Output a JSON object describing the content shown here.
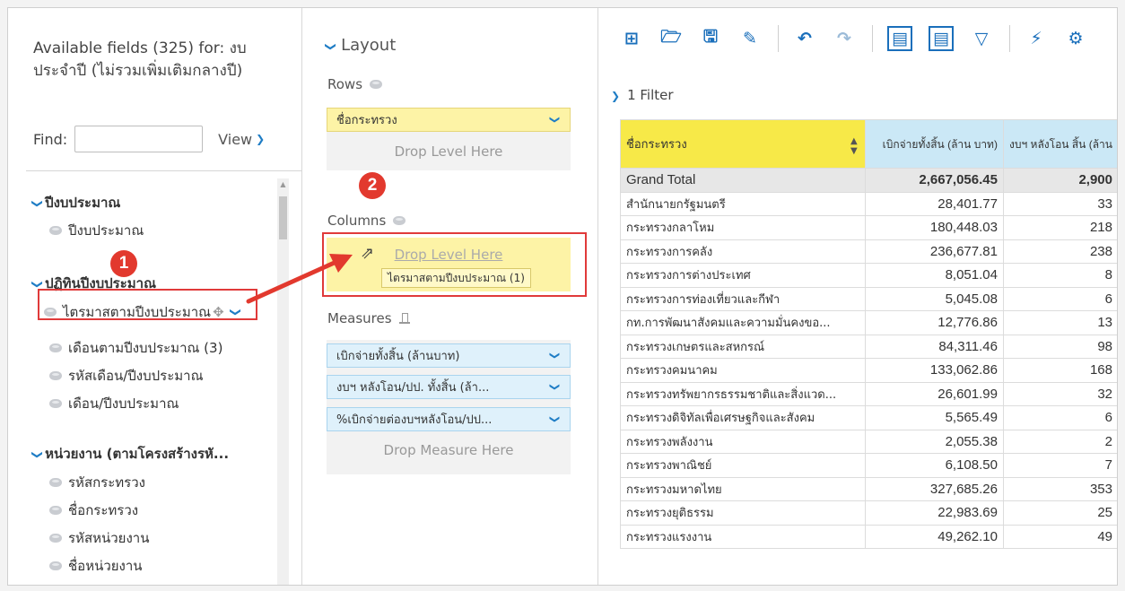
{
  "fields_panel": {
    "title": "Available fields (325) for: งบประจำปี (ไม่รวมเพิ่มเติมกลางปี)",
    "find_label": "Find:",
    "find_value": "",
    "view_label": "View",
    "tree": [
      {
        "group": "ปีงบประมาณ",
        "items": [
          "ปีงบประมาณ"
        ]
      },
      {
        "group": "ปฏิทินปีงบประมาณ",
        "items": [
          "ไตรมาสตามปีงบประมาณ",
          "เดือนตามปีงบประมาณ (3)",
          "รหัสเดือน/ปีงบประมาณ",
          "เดือน/ปีงบประมาณ"
        ]
      },
      {
        "group": "หน่วยงาน (ตามโครงสร้างรหั...",
        "items": [
          "รหัสกระทรวง",
          "ชื่อกระทรวง",
          "รหัสหน่วยงาน",
          "ชื่อหน่วยงาน"
        ]
      }
    ]
  },
  "layout_panel": {
    "title": "Layout",
    "rows_label": "Rows",
    "rows_field": "ชื่อกระทรวง",
    "rows_drop": "Drop Level Here",
    "columns_label": "Columns",
    "columns_drop": "Drop Level Here",
    "drag_tooltip": "ไตรมาสตามปีงบประมาณ (1)",
    "measures_label": "Measures",
    "measures": [
      "เบิกจ่ายทั้งสิ้น (ล้านบาท)",
      "งบฯ หลังโอน/ปป. ทั้งสิ้น (ล้า...",
      "%เบิกจ่ายต่องบฯหลังโอน/ปป..."
    ],
    "measures_drop": "Drop Measure Here"
  },
  "annotations": {
    "step1": "1",
    "step2": "2",
    "accent": "#e2392e"
  },
  "toolbar": {
    "icons": [
      "new-report-icon",
      "open-folder-icon",
      "save-icon",
      "save-as-icon",
      "undo-icon",
      "redo-icon",
      "layout-panel-icon",
      "fields-panel-icon",
      "filter-icon",
      "auto-refresh-icon",
      "settings-icon"
    ]
  },
  "filter_bar": {
    "label": "1 Filter"
  },
  "grid": {
    "header_row": "ชื่อกระทรวง",
    "header_m1": "เบิกจ่ายทั้งสิ้น (ล้าน บาท)",
    "header_m2": "งบฯ หลังโอน สิ้น (ล้าน",
    "grand_total_label": "Grand Total",
    "grand_total_v1": "2,667,056.45",
    "grand_total_v2": "2,900",
    "rows": [
      {
        "name": "สำนักนายกรัฐมนตรี",
        "v1": "28,401.77",
        "v2": "33"
      },
      {
        "name": "กระทรวงกลาโหม",
        "v1": "180,448.03",
        "v2": "218"
      },
      {
        "name": "กระทรวงการคลัง",
        "v1": "236,677.81",
        "v2": "238"
      },
      {
        "name": "กระทรวงการต่างประเทศ",
        "v1": "8,051.04",
        "v2": "8"
      },
      {
        "name": "กระทรวงการท่องเที่ยวและกีฬา",
        "v1": "5,045.08",
        "v2": "6"
      },
      {
        "name": "กท.การพัฒนาสังคมและความมั่นคงขอ...",
        "v1": "12,776.86",
        "v2": "13"
      },
      {
        "name": "กระทรวงเกษตรและสหกรณ์",
        "v1": "84,311.46",
        "v2": "98"
      },
      {
        "name": "กระทรวงคมนาคม",
        "v1": "133,062.86",
        "v2": "168"
      },
      {
        "name": "กระทรวงทรัพยากรธรรมชาติและสิ่งแวด...",
        "v1": "26,601.99",
        "v2": "32"
      },
      {
        "name": "กระทรวงดิจิทัลเพื่อเศรษฐกิจและสังคม",
        "v1": "5,565.49",
        "v2": "6"
      },
      {
        "name": "กระทรวงพลังงาน",
        "v1": "2,055.38",
        "v2": "2"
      },
      {
        "name": "กระทรวงพาณิชย์",
        "v1": "6,108.50",
        "v2": "7"
      },
      {
        "name": "กระทรวงมหาดไทย",
        "v1": "327,685.26",
        "v2": "353"
      },
      {
        "name": "กระทรวงยุติธรรม",
        "v1": "22,983.69",
        "v2": "25"
      },
      {
        "name": "กระทรวงแรงงาน",
        "v1": "49,262.10",
        "v2": "49"
      }
    ]
  }
}
